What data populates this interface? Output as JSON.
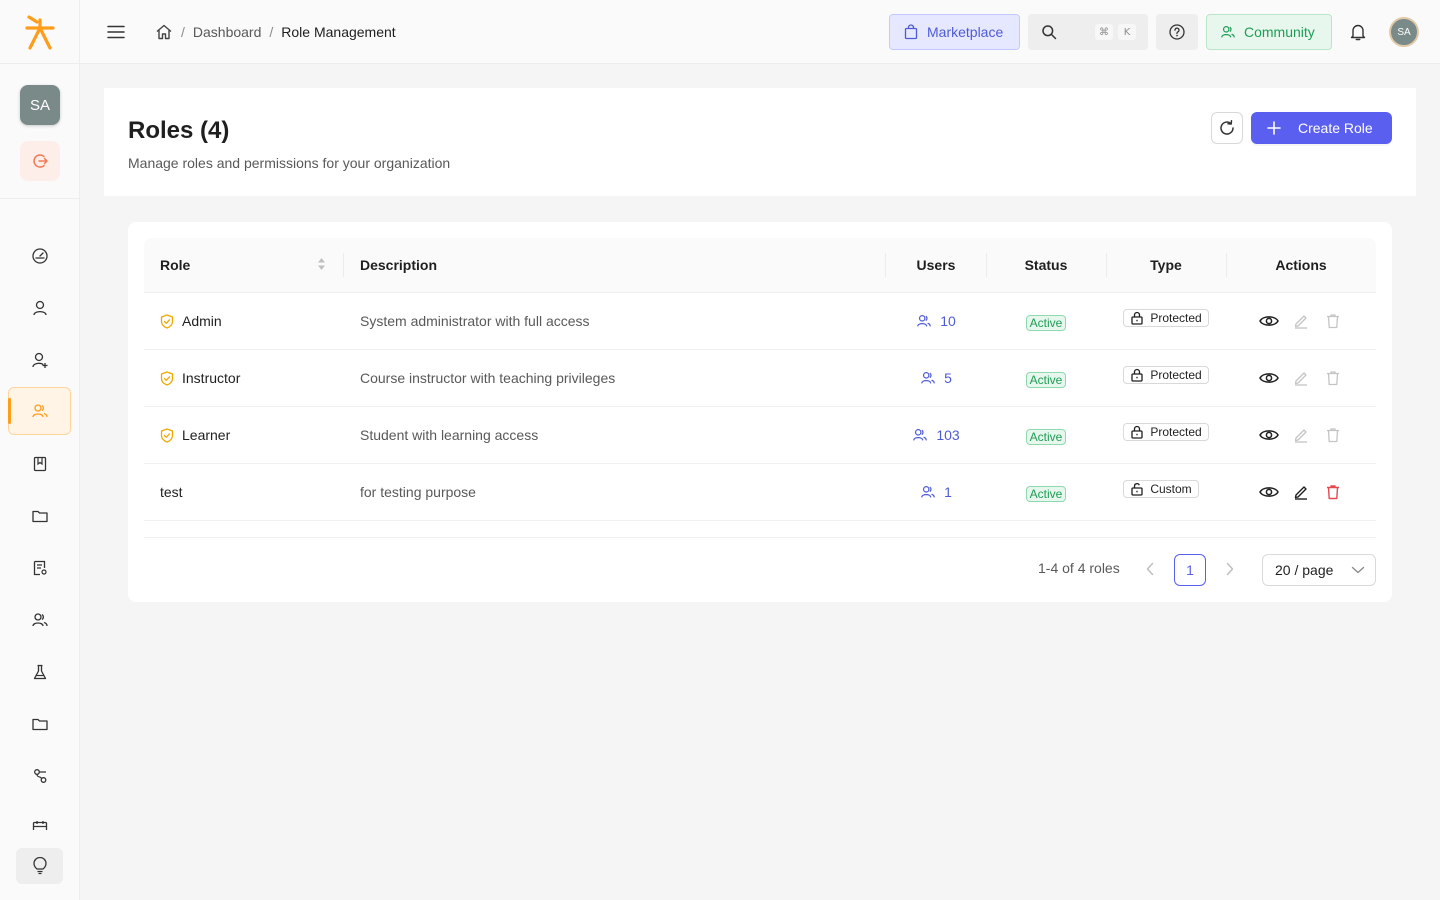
{
  "sidebar": {
    "avatar_initials": "SA",
    "nav_icons": [
      "dashboard-icon",
      "user-icon",
      "user-add-icon",
      "roles-icon",
      "book-icon",
      "folder-icon",
      "report-icon",
      "team-icon",
      "flask-icon",
      "folder-icon",
      "workflow-icon",
      "calendar-icon"
    ],
    "active_item": "roles-icon",
    "bottom_icon": "lightbulb-icon"
  },
  "header": {
    "breadcrumb": {
      "home_icon": "home-icon",
      "items": [
        "Dashboard",
        "Role Management"
      ],
      "separator": "/"
    },
    "marketplace_label": "Marketplace",
    "search_shortcut": [
      "⌘",
      "K"
    ],
    "community_label": "Community",
    "avatar_initials": "SA"
  },
  "page": {
    "title": "Roles (4)",
    "subtitle": "Manage roles and permissions for your organization",
    "create_label": "Create Role"
  },
  "table": {
    "columns": [
      "Role",
      "Description",
      "Users",
      "Status",
      "Type",
      "Actions"
    ],
    "rows": [
      {
        "role": "Admin",
        "protected_icon": true,
        "description": "System administrator with full access",
        "users": "10",
        "status": "Active",
        "type": "Protected",
        "editable": false
      },
      {
        "role": "Instructor",
        "protected_icon": true,
        "description": "Course instructor with teaching privileges",
        "users": "5",
        "status": "Active",
        "type": "Protected",
        "editable": false
      },
      {
        "role": "Learner",
        "protected_icon": true,
        "description": "Student with learning access",
        "users": "103",
        "status": "Active",
        "type": "Protected",
        "editable": false
      },
      {
        "role": "test",
        "protected_icon": false,
        "description": "for testing purpose",
        "users": "1",
        "status": "Active",
        "type": "Custom",
        "editable": true
      }
    ]
  },
  "pagination": {
    "total_text": "1-4 of 4 roles",
    "current_page": "1",
    "page_size": "20 / page"
  },
  "colors": {
    "accent": "#5b5ff0",
    "brand_orange": "#ff9d1a",
    "success": "#1f9d55",
    "danger": "#e5484d"
  }
}
